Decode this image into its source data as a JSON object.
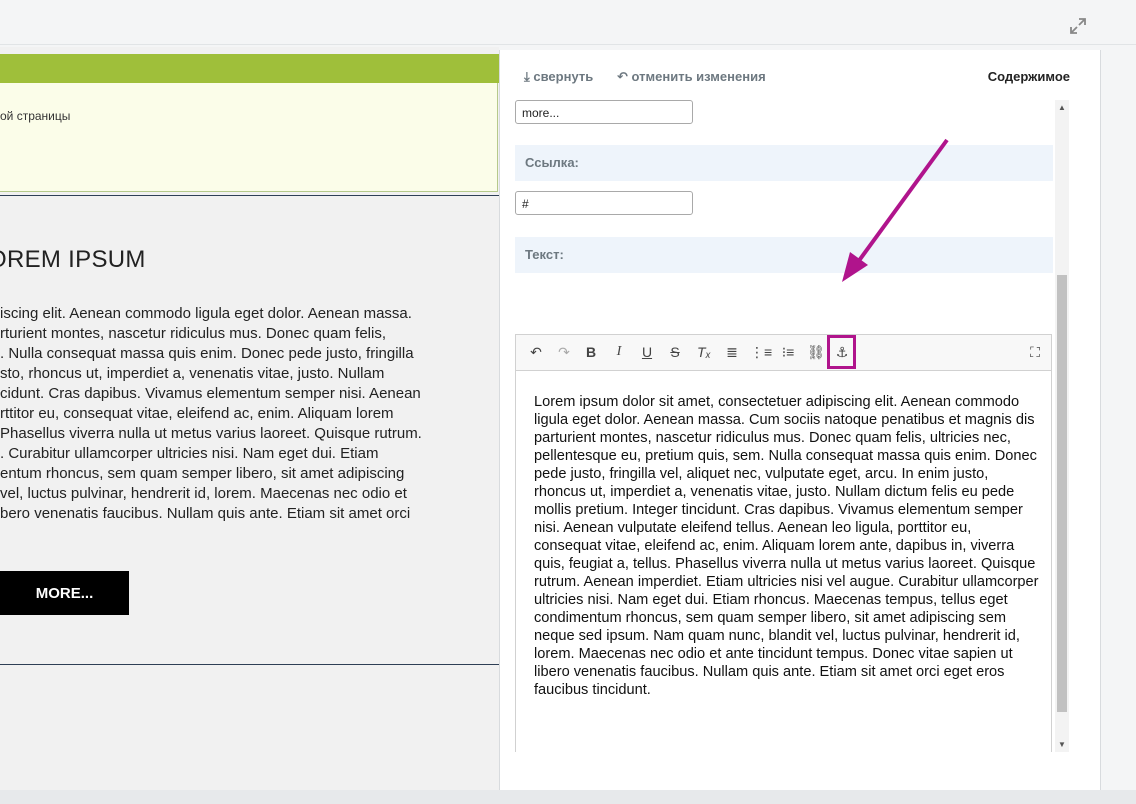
{
  "preview": {
    "page_text": "ой страницы",
    "heading": "OREM IPSUM",
    "paragraph_lines": [
      "iscing elit. Aenean commodo ligula eget dolor. Aenean massa.",
      "rturient montes, nascetur ridiculus mus. Donec quam felis,",
      ". Nulla consequat massa quis enim. Donec pede justo, fringilla",
      "sto, rhoncus ut, imperdiet a, venenatis vitae, justo. Nullam",
      "cidunt. Cras dapibus. Vivamus elementum semper nisi. Aenean",
      "rttitor eu, consequat vitae, eleifend ac, enim. Aliquam lorem",
      "Phasellus viverra nulla ut metus varius laoreet. Quisque rutrum.",
      ". Curabitur ullamcorper ultricies nisi. Nam eget dui. Etiam",
      "entum rhoncus, sem quam semper libero, sit amet adipiscing",
      " vel, luctus pulvinar, hendrerit id, lorem. Maecenas nec odio et",
      "bero venenatis faucibus. Nullam quis ante. Etiam sit amet orci"
    ],
    "more_button": "MORE..."
  },
  "panel": {
    "collapse_label": "свернуть",
    "undo_label": "отменить изменения",
    "content_title": "Содержимое",
    "fields": {
      "more_value": "more...",
      "link_label": "Ссылка:",
      "link_value": "#",
      "text_label": "Текст:"
    },
    "editor_text": "Lorem ipsum dolor sit amet, consectetuer adipiscing elit. Aenean commodo ligula eget dolor. Aenean massa. Cum sociis natoque penatibus et magnis dis parturient montes, nascetur ridiculus mus. Donec quam felis, ultricies nec, pellentesque eu, pretium quis, sem. Nulla consequat massa quis enim. Donec pede justo, fringilla vel, aliquet nec, vulputate eget, arcu. In enim justo, rhoncus ut, imperdiet a, venenatis vitae, justo. Nullam dictum felis eu pede mollis pretium. Integer tincidunt. Cras dapibus. Vivamus elementum semper nisi. Aenean vulputate eleifend tellus. Aenean leo ligula, porttitor eu, consequat vitae, eleifend ac, enim. Aliquam lorem ante, dapibus in, viverra quis, feugiat a, tellus. Phasellus viverra nulla ut metus varius laoreet. Quisque rutrum. Aenean imperdiet. Etiam ultricies nisi vel augue. Curabitur ullamcorper ultricies nisi. Nam eget dui. Etiam rhoncus. Maecenas tempus, tellus eget condimentum rhoncus, sem quam semper libero, sit amet adipiscing sem neque sed ipsum. Nam quam nunc, blandit vel, luctus pulvinar, hendrerit id, lorem. Maecenas nec odio et ante tincidunt tempus. Donec vitae sapien ut libero venenatis faucibus. Nullam quis ante. Etiam sit amet orci eget eros faucibus tincidunt."
  },
  "toolbar_icons": [
    "undo-icon",
    "redo-icon",
    "bold-icon",
    "italic-icon",
    "underline-icon",
    "strikethrough-icon",
    "remove-format-icon",
    "align-justify-icon",
    "numbered-list-icon",
    "bullet-list-icon",
    "link-icon",
    "anchor-icon",
    "maximize-icon"
  ],
  "colors": {
    "accent_green": "#9fbf3a",
    "highlight_magenta": "#b0148c",
    "more_button_bg": "#000000"
  }
}
